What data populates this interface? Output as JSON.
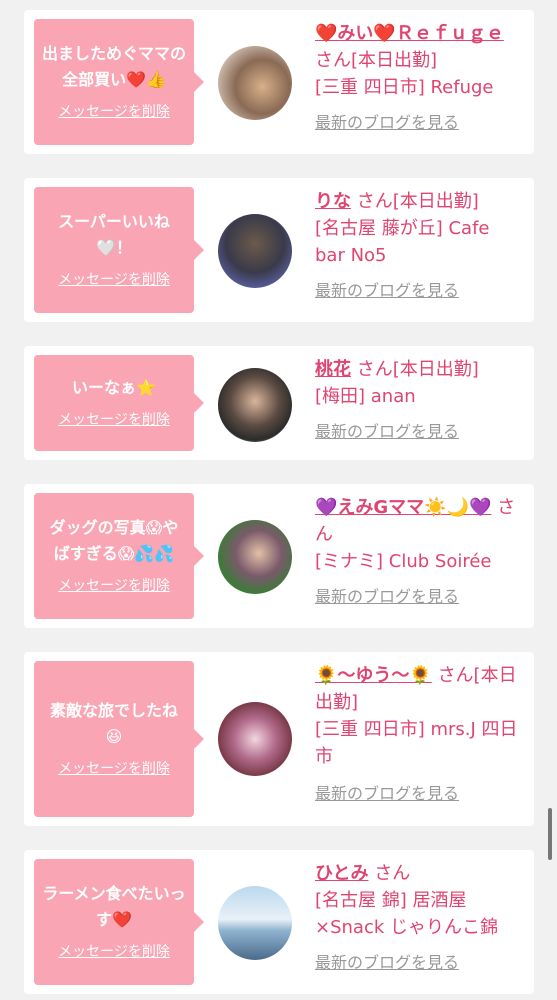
{
  "common": {
    "delete_label": "メッセージを削除",
    "blog_label": "最新のブログを見る",
    "san": "さん"
  },
  "items": [
    {
      "message": "出ましためぐママの全部買い❤️👍",
      "name": "❤️みい❤️Ｒｅｆｕｇｅ",
      "status": "さん[本日出勤]",
      "location": "[三重 四日市] Refuge"
    },
    {
      "message": "スーパーいいね🤍！",
      "name": "りな",
      "status": "さん[本日出勤]",
      "location": "[名古屋 藤が丘] Cafe bar No5"
    },
    {
      "message": "いーなぁ⭐",
      "name": "桃花",
      "status": "さん[本日出勤]",
      "location": "[梅田] anan"
    },
    {
      "message": "ダッグの写真😱やばすぎる😱💦💦",
      "name": "💜えみGママ☀️🌙💜",
      "status": "さん",
      "location": "[ミナミ] Club Soirée"
    },
    {
      "message": "素敵な旅でしたね😆",
      "name": "🌻〜ゆう〜🌻",
      "status": "さん[本日出勤]",
      "location": "[三重 四日市] mrs.J 四日市"
    },
    {
      "message": "ラーメン食べたいっす❤️",
      "name": "ひとみ",
      "status": "さん",
      "location": "[名古屋 錦] 居酒屋×Snack じゃりんこ錦"
    }
  ],
  "colors": {
    "background": "#f1f1f1",
    "bubble": "#f9a5b4",
    "accent_text": "#e04470",
    "muted_text": "#999999"
  }
}
